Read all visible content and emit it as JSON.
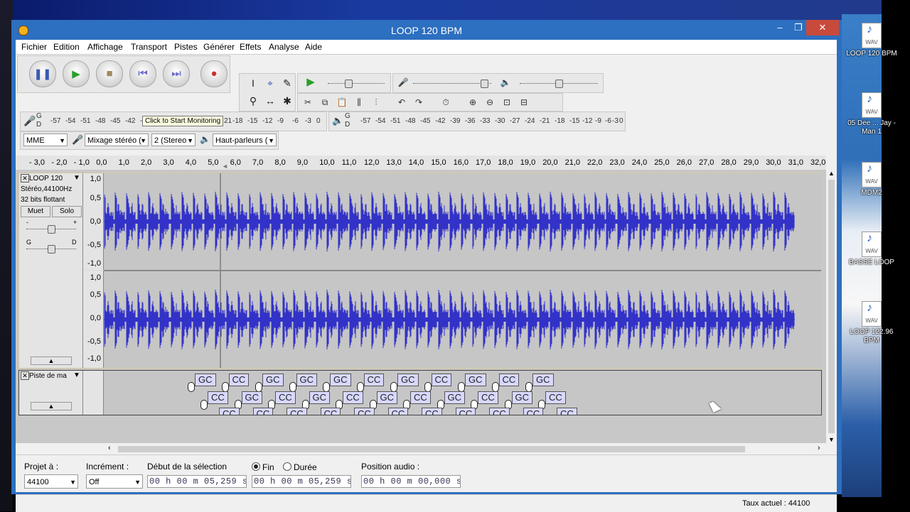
{
  "window": {
    "title": "LOOP 120 BPM",
    "minimize": "–",
    "maximize": "❐",
    "close": "✕"
  },
  "menu": [
    "Fichier",
    "Edition",
    "Affichage",
    "Transport",
    "Pistes",
    "Générer",
    "Effets",
    "Analyse",
    "Aide"
  ],
  "transport": {
    "pause": "❚❚",
    "play": "▶",
    "stop": "■",
    "skip_start": "⏮",
    "skip_end": "⏭",
    "record": "●"
  },
  "tools": {
    "select": "I",
    "envelope": "⌖",
    "draw": "✎",
    "zoom": "⚲",
    "timeshift": "↔",
    "multi": "✱"
  },
  "meters": {
    "record_scale": [
      "G",
      "D",
      "-57",
      "-54",
      "-51",
      "-48",
      "-45",
      "-42",
      "-3"
    ],
    "record_tooltip": "Click to Start Monitoring",
    "record_tail": [
      "21",
      "-18",
      "-15",
      "-12",
      "-9",
      "-6",
      "-3",
      "0"
    ],
    "play_scale": [
      "G",
      "D",
      "-57",
      "-54",
      "-51",
      "-48",
      "-45",
      "-42",
      "-39",
      "-36",
      "-33",
      "-30",
      "-27",
      "-24",
      "-21",
      "-18",
      "-15",
      "-12",
      "-9",
      "-6",
      "-3",
      "0"
    ]
  },
  "mixer": {
    "record_volume": 0.9,
    "play_volume": 0.45
  },
  "device": {
    "host": "MME",
    "input": "Mixage stéréo (",
    "channels": "2 (Stereo",
    "output": "Haut-parleurs ("
  },
  "ruler": [
    "- 3,0",
    "- 2,0",
    "- 1,0",
    "0,0",
    "1,0",
    "2,0",
    "3,0",
    "4,0",
    "5,0",
    "6,0",
    "7,0",
    "8,0",
    "9,0",
    "10,0",
    "11,0",
    "12,0",
    "13,0",
    "14,0",
    "15,0",
    "16,0",
    "17,0",
    "18,0",
    "19,0",
    "20,0",
    "21,0",
    "22,0",
    "23,0",
    "24,0",
    "25,0",
    "26,0",
    "27,0",
    "28,0",
    "29,0",
    "30,0",
    "31,0",
    "32,0"
  ],
  "audio_track": {
    "name": "LOOP 120",
    "format": "Stéréo,44100Hz",
    "bits": "32 bits flottant",
    "mute": "Muet",
    "solo": "Solo",
    "gain_minus": "-",
    "gain_plus": "+",
    "pan_left": "G",
    "pan_right": "D",
    "scale": [
      "1,0",
      "0,5",
      "0,0",
      "-0,5",
      "-1,0"
    ]
  },
  "label_track": {
    "name": "Piste de ma",
    "labels_row1": [
      "GC",
      "CC",
      "GC",
      "GC",
      "GC",
      "CC",
      "GC",
      "CC",
      "GC",
      "CC",
      "GC"
    ],
    "labels_row2": [
      "CC",
      "GC",
      "CC",
      "GC",
      "CC",
      "GC",
      "CC",
      "GC",
      "CC",
      "GC",
      "CC"
    ],
    "labels_row3": [
      "CC",
      "CC",
      "CC",
      "CC",
      "CC",
      "CC",
      "CC",
      "CC",
      "CC",
      "CC",
      "CC"
    ]
  },
  "selection": {
    "rate_label": "Projet à :",
    "rate_value": "44100",
    "snap_label": "Incrément :",
    "snap_value": "Off",
    "start_label": "Début de la sélection",
    "end_label": "Fin",
    "length_label": "Durée",
    "start_time": "00 h 00 m 05,259 s",
    "end_time": "00 h 00 m 05,259 s",
    "audio_pos_label": "Position audio :",
    "audio_pos": "00 h 00 m 00,000 s"
  },
  "status": {
    "rate": "Taux actuel : 44100"
  },
  "desktop_icons": [
    {
      "label": "LOOP 120 BPM",
      "ext": "WAV"
    },
    {
      "label": "05 Dee ... Jay - Man 1",
      "ext": "WAV"
    },
    {
      "label": "MDM2",
      "ext": "WAV"
    },
    {
      "label": "BASSE LOOP",
      "ext": "WAV"
    },
    {
      "label": "LOOP 122.96 BPM",
      "ext": "WAV"
    }
  ],
  "colors": {
    "titlebar": "#2d6fc0",
    "waveform": "#3232c8",
    "close": "#c84a3a",
    "label_fill": "#d8d8ff"
  }
}
